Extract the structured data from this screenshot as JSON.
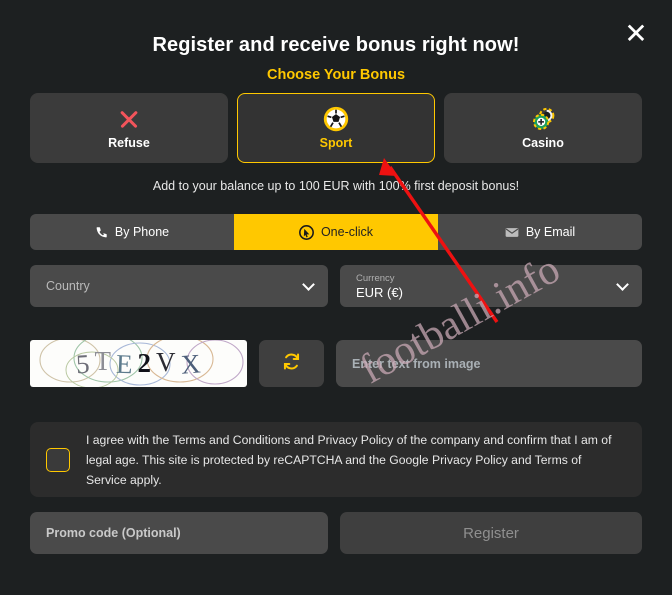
{
  "dialog": {
    "title": "Register and receive bonus right now!",
    "subtitle": "Choose Your Bonus",
    "close_icon": "close-icon",
    "promo_line": "Add to your balance up to 100 EUR with 100% first deposit bonus!"
  },
  "bonus_options": [
    {
      "label": "Refuse",
      "icon": "cross-icon",
      "selected": false
    },
    {
      "label": "Sport",
      "icon": "soccer-ball-icon",
      "selected": true
    },
    {
      "label": "Casino",
      "icon": "casino-chips-icon",
      "selected": false
    }
  ],
  "method_tabs": [
    {
      "label": "By Phone",
      "icon": "phone-icon",
      "active": false
    },
    {
      "label": "One-click",
      "icon": "one-click-cursor-icon",
      "active": true
    },
    {
      "label": "By Email",
      "icon": "envelope-icon",
      "active": false
    }
  ],
  "fields": {
    "country": {
      "placeholder": "Country",
      "value": ""
    },
    "currency": {
      "label": "Currency",
      "value": "EUR (€)"
    },
    "captcha": {
      "image_text": "5TE2VX",
      "characters": [
        "5",
        "T",
        "E",
        "2",
        "V",
        "X"
      ],
      "refresh_icon": "refresh-icon",
      "input_placeholder": "Enter text from image"
    },
    "promo_code": {
      "placeholder": "Promo code (Optional)",
      "value": ""
    }
  },
  "terms": {
    "checked": false,
    "text": "I agree with the Terms and Conditions and Privacy Policy of the company and confirm that I am of legal age. This site is protected by reCAPTCHA and the Google Privacy Policy and Terms of Service apply."
  },
  "actions": {
    "register_label": "Register"
  },
  "overlay": {
    "watermark_text": "footballi.info",
    "arrow_color": "#ee1111"
  },
  "colors": {
    "accent": "#ffc800",
    "background": "#1d2021",
    "panel": "#3b3b3b",
    "field": "#4a4a4a",
    "refuse": "#f2545b"
  }
}
